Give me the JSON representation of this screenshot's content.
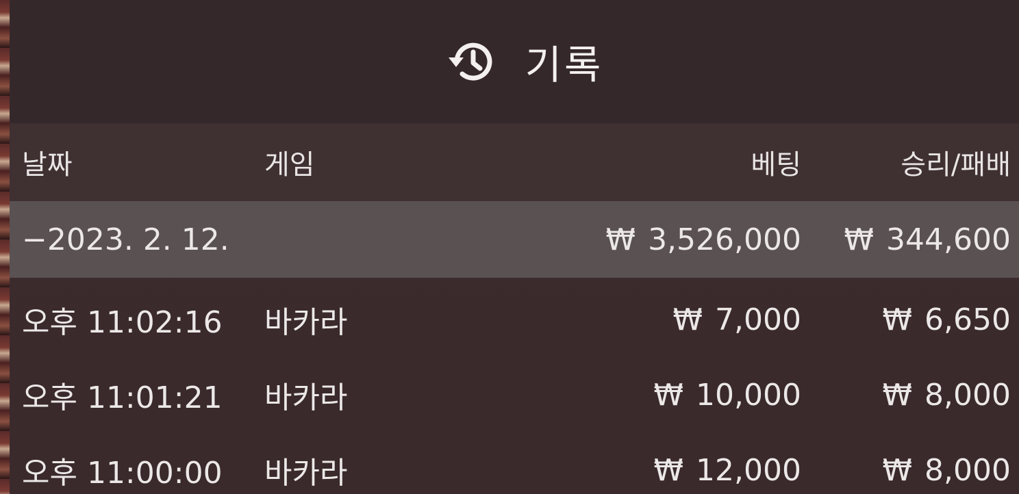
{
  "header": {
    "title": "기록",
    "icon": "history-icon"
  },
  "columns": {
    "date": "날짜",
    "game": "게임",
    "bet": "베팅",
    "result": "승리/패배"
  },
  "summary": {
    "date": "−2023. 2. 12.",
    "currency": "₩",
    "bet": "3,526,000",
    "result": "344,600"
  },
  "rows": [
    {
      "time": "오후 11:02:16",
      "game": "바카라",
      "currency": "₩",
      "bet": "7,000",
      "result": "6,650"
    },
    {
      "time": "오후 11:01:21",
      "game": "바카라",
      "currency": "₩",
      "bet": "10,000",
      "result": "8,000"
    },
    {
      "time": "오후 11:00:00",
      "game": "바카라",
      "currency": "₩",
      "bet": "12,000",
      "result": "8,000"
    }
  ],
  "colors": {
    "panel": "#3a2a2c",
    "header": "#35282a",
    "summary_row": "#5a5152",
    "text": "#f2eeee"
  }
}
